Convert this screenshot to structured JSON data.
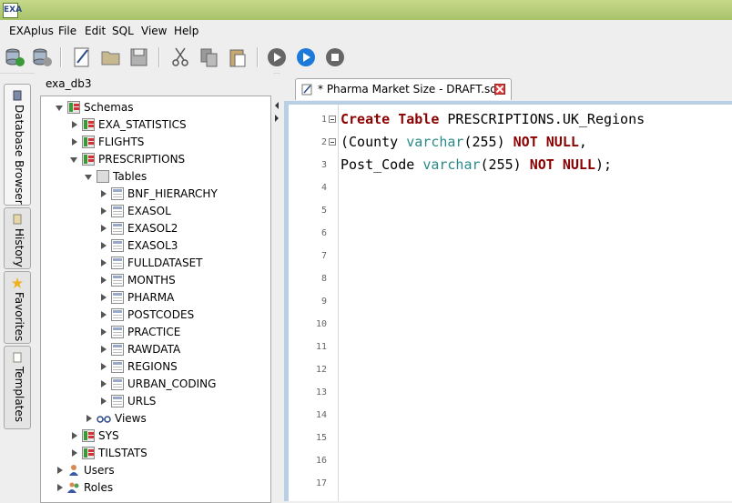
{
  "window": {
    "app_icon_text": "EXA"
  },
  "menu": [
    "EXAplus",
    "File",
    "Edit",
    "SQL",
    "View",
    "Help"
  ],
  "toolbar": {
    "buttons": [
      "connect-icon",
      "disconnect-icon",
      "new-file-icon",
      "open-folder-icon",
      "save-icon",
      "cut-icon",
      "copy-icon",
      "paste-icon",
      "execute-statement-icon",
      "execute-all-icon",
      "stop-icon"
    ]
  },
  "side_tabs": [
    {
      "label": "Database Browser",
      "icon": "database-icon"
    },
    {
      "label": "History",
      "icon": "history-icon"
    },
    {
      "label": "Favorites",
      "icon": "star-icon"
    },
    {
      "label": "Templates",
      "icon": "template-icon"
    }
  ],
  "browser": {
    "db_name": "exa_db3",
    "tree": [
      {
        "label": "Schemas",
        "level": 1,
        "state": "expanded",
        "icon": "schemas"
      },
      {
        "label": "EXA_STATISTICS",
        "level": 2,
        "state": "collapsed",
        "icon": "schema"
      },
      {
        "label": "FLIGHTS",
        "level": 2,
        "state": "collapsed",
        "icon": "schema"
      },
      {
        "label": "PRESCRIPTIONS",
        "level": 2,
        "state": "expanded",
        "icon": "schema"
      },
      {
        "label": "Tables",
        "level": 3,
        "state": "expanded",
        "icon": "tables"
      },
      {
        "label": "BNF_HIERARCHY",
        "level": 4,
        "state": "collapsed",
        "icon": "table"
      },
      {
        "label": "EXASOL",
        "level": 4,
        "state": "collapsed",
        "icon": "table"
      },
      {
        "label": "EXASOL2",
        "level": 4,
        "state": "collapsed",
        "icon": "table"
      },
      {
        "label": "EXASOL3",
        "level": 4,
        "state": "collapsed",
        "icon": "table"
      },
      {
        "label": "FULLDATASET",
        "level": 4,
        "state": "collapsed",
        "icon": "table"
      },
      {
        "label": "MONTHS",
        "level": 4,
        "state": "collapsed",
        "icon": "table"
      },
      {
        "label": "PHARMA",
        "level": 4,
        "state": "collapsed",
        "icon": "table"
      },
      {
        "label": "POSTCODES",
        "level": 4,
        "state": "collapsed",
        "icon": "table"
      },
      {
        "label": "PRACTICE",
        "level": 4,
        "state": "collapsed",
        "icon": "table"
      },
      {
        "label": "RAWDATA",
        "level": 4,
        "state": "collapsed",
        "icon": "table"
      },
      {
        "label": "REGIONS",
        "level": 4,
        "state": "collapsed",
        "icon": "table"
      },
      {
        "label": "URBAN_CODING",
        "level": 4,
        "state": "collapsed",
        "icon": "table"
      },
      {
        "label": "URLS",
        "level": 4,
        "state": "collapsed",
        "icon": "table"
      },
      {
        "label": "Views",
        "level": 3,
        "state": "collapsed",
        "icon": "views"
      },
      {
        "label": "SYS",
        "level": 2,
        "state": "collapsed",
        "icon": "schema"
      },
      {
        "label": "TILSTATS",
        "level": 2,
        "state": "collapsed",
        "icon": "schema"
      },
      {
        "label": "Users",
        "level": 1,
        "state": "collapsed",
        "icon": "users"
      },
      {
        "label": "Roles",
        "level": 1,
        "state": "collapsed",
        "icon": "roles"
      }
    ]
  },
  "editor": {
    "tab_title": "* Pharma Market Size - DRAFT.sql",
    "line_numbers": [
      "1",
      "2",
      "3",
      "4",
      "5",
      "6",
      "7",
      "8",
      "9",
      "10",
      "11",
      "12",
      "13",
      "14",
      "15",
      "16",
      "17"
    ],
    "lines": [
      [
        {
          "t": "Create Table",
          "c": "kw"
        },
        {
          "t": " PRESCRIPTIONS.UK_Regions",
          "c": ""
        }
      ],
      [
        {
          "t": "(County ",
          "c": ""
        },
        {
          "t": "varchar",
          "c": "ty"
        },
        {
          "t": "(255) ",
          "c": ""
        },
        {
          "t": "NOT NULL",
          "c": "kw"
        },
        {
          "t": ",",
          "c": ""
        }
      ],
      [
        {
          "t": "Post_Code ",
          "c": ""
        },
        {
          "t": "varchar",
          "c": "ty"
        },
        {
          "t": "(255) ",
          "c": ""
        },
        {
          "t": "NOT NULL",
          "c": "kw"
        },
        {
          "t": ");",
          "c": ""
        }
      ]
    ],
    "colors": {
      "keyword": "#8b0000",
      "type": "#2a8a8a"
    }
  }
}
